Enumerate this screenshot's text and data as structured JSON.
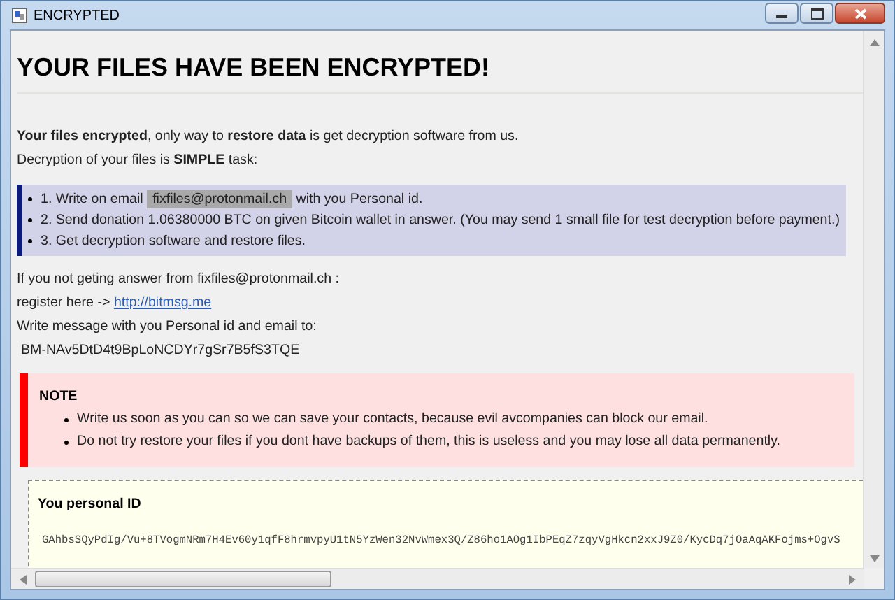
{
  "window": {
    "title": "ENCRYPTED"
  },
  "heading": "YOUR FILES HAVE BEEN ENCRYPTED!",
  "intro": [
    "**Your files encrypted**, only way to **restore data** is get decryption software from us.",
    "Decryption of your files is **SIMPLE** task:"
  ],
  "steps": [
    {
      "text": "1. Write on email",
      "highlight": "fixfiles@protonmail.ch",
      "after": "with you Personal id."
    },
    {
      "text": "2. Send donation 1.06380000 BTC on given Bitcoin wallet in answer. (You may send 1 small file for test decryption before payment.)"
    },
    {
      "text": "3. Get decryption software and restore files."
    }
  ],
  "contact": [
    {
      "kind": "text",
      "text": "If you not geting answer from fixfiles@protonmail.ch :"
    },
    {
      "kind": "link",
      "text": "register here ->",
      "link": "http://bitmsg.me"
    },
    {
      "kind": "text",
      "text": "Write message with you Personal id and email to:"
    },
    {
      "kind": "text",
      "text": "BM-NAv5DtD4t9BpLoNCDYr7gSr7B5fS3TQE"
    }
  ],
  "note": {
    "title": "NOTE",
    "items": [
      "Write us soon as you can so we can save your contacts, because evil avcompanies can block our email.",
      "Do not try restore your files if you dont have backups of them, this is useless and you may lose all data permanently."
    ]
  },
  "personal_id": {
    "title": "You personal ID",
    "value": "GAhbsSQyPdIg/Vu+8TVogmNRm7H4Ev60y1qfF8hrmvpyU1tN5YzWen32NvWmex3Q/Z86ho1AOg1IbPEqZ7zqyVgHkcn2xxJ9Z0/KycDq7jOaAqAKFojms+OgvS"
  }
}
